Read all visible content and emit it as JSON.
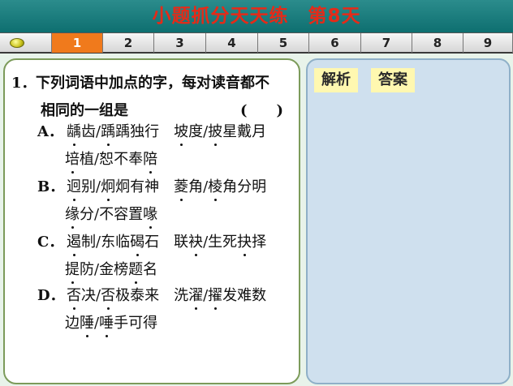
{
  "title": "小题抓分天天练　第8天",
  "tabs": [
    "1",
    "2",
    "3",
    "4",
    "5",
    "6",
    "7",
    "8",
    "9"
  ],
  "active_tab": "1",
  "buttons": {
    "analysis": "解析",
    "answer": "答案"
  },
  "question": {
    "number": "1．",
    "stem_1": "下列词语中加点的字，每对读音都不",
    "stem_2": "相同的一组是",
    "blank": "(　　)",
    "options": [
      {
        "letter": "A．",
        "line1": [
          {
            "t": "龋",
            "d": true
          },
          {
            "t": "齿/",
            "d": false
          },
          {
            "t": "踽",
            "d": true
          },
          {
            "t": "踽独行　",
            "d": false
          },
          {
            "t": "坡",
            "d": true
          },
          {
            "t": "度/",
            "d": false
          },
          {
            "t": "披",
            "d": true
          },
          {
            "t": "星戴月",
            "d": false
          }
        ],
        "line2": [
          {
            "t": "培",
            "d": true
          },
          {
            "t": "植/恕不奉",
            "d": false
          },
          {
            "t": "陪",
            "d": true
          }
        ]
      },
      {
        "letter": "B．",
        "line1": [
          {
            "t": "迥",
            "d": true
          },
          {
            "t": "别/",
            "d": false
          },
          {
            "t": "炯",
            "d": true
          },
          {
            "t": "炯有神　",
            "d": false
          },
          {
            "t": "菱",
            "d": true
          },
          {
            "t": "角/",
            "d": false
          },
          {
            "t": "棱",
            "d": true
          },
          {
            "t": "角分明",
            "d": false
          }
        ],
        "line2": [
          {
            "t": "缘",
            "d": true
          },
          {
            "t": "分/不容置",
            "d": false
          },
          {
            "t": "喙",
            "d": true
          }
        ]
      },
      {
        "letter": "C．",
        "line1": [
          {
            "t": "遏",
            "d": true
          },
          {
            "t": "制/东临",
            "d": false
          },
          {
            "t": "碣",
            "d": true
          },
          {
            "t": "石　",
            "d": false
          },
          {
            "t": "联",
            "d": false
          },
          {
            "t": "袂",
            "d": true
          },
          {
            "t": "/生死",
            "d": false
          },
          {
            "t": "抉",
            "d": true
          },
          {
            "t": "择",
            "d": false
          }
        ],
        "line2": [
          {
            "t": "提",
            "d": true
          },
          {
            "t": "防/金榜",
            "d": false
          },
          {
            "t": "题",
            "d": true
          },
          {
            "t": "名",
            "d": false
          }
        ]
      },
      {
        "letter": "D．",
        "line1": [
          {
            "t": "否",
            "d": true
          },
          {
            "t": "决/",
            "d": false
          },
          {
            "t": "否",
            "d": true
          },
          {
            "t": "极泰来　",
            "d": false
          },
          {
            "t": "洗",
            "d": false
          },
          {
            "t": "濯",
            "d": true
          },
          {
            "t": "/",
            "d": false
          },
          {
            "t": "擢",
            "d": true
          },
          {
            "t": "发难数",
            "d": false
          }
        ],
        "line2": [
          {
            "t": "边",
            "d": false
          },
          {
            "t": "陲",
            "d": true
          },
          {
            "t": "/",
            "d": false
          },
          {
            "t": "唾",
            "d": true
          },
          {
            "t": "手可得",
            "d": false
          }
        ]
      }
    ]
  }
}
